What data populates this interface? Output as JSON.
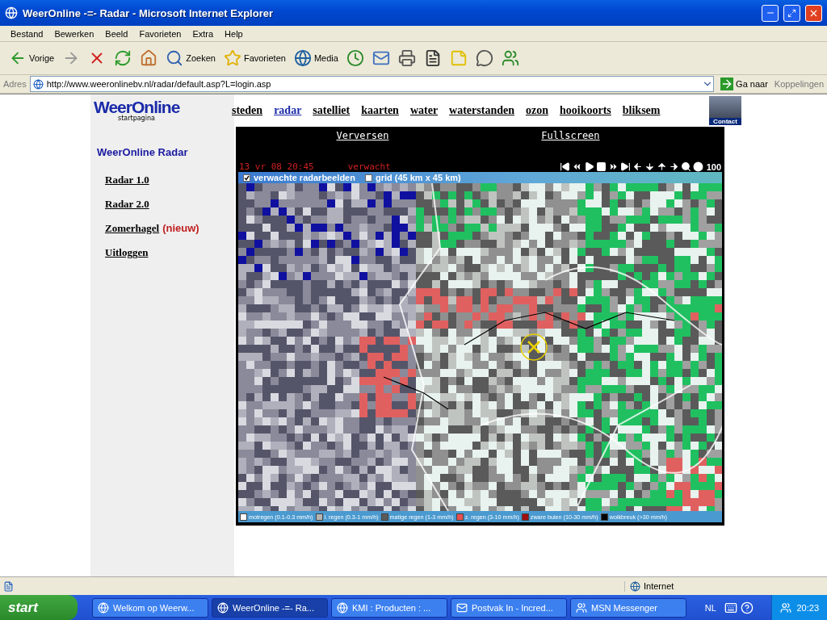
{
  "window": {
    "title": "WeerOnline -=- Radar - Microsoft Internet Explorer"
  },
  "menu": [
    "Bestand",
    "Bewerken",
    "Beeld",
    "Favorieten",
    "Extra",
    "Help"
  ],
  "toolbar": [
    {
      "kind": "back",
      "label": "Vorige"
    },
    {
      "kind": "forward"
    },
    {
      "kind": "stop"
    },
    {
      "kind": "refresh"
    },
    {
      "kind": "home"
    },
    {
      "kind": "search",
      "label": "Zoeken"
    },
    {
      "kind": "favorites",
      "label": "Favorieten"
    },
    {
      "kind": "media",
      "label": "Media"
    },
    {
      "kind": "history"
    },
    {
      "kind": "mail"
    },
    {
      "kind": "print"
    },
    {
      "kind": "edit"
    },
    {
      "kind": "note"
    },
    {
      "kind": "discuss"
    },
    {
      "kind": "messenger"
    }
  ],
  "address": {
    "label": "Adres",
    "url": "http://www.weeronlinebv.nl/radar/default.asp?L=login.asp",
    "go": "Ga naar",
    "links": "Koppelingen"
  },
  "site": {
    "logo": "WeerOnline",
    "logo_subtitle": "startpagina",
    "contact": "Contact",
    "nav": [
      {
        "label": "steden",
        "selected": false
      },
      {
        "label": "radar",
        "selected": true
      },
      {
        "label": "satelliet",
        "selected": false
      },
      {
        "label": "kaarten",
        "selected": false
      },
      {
        "label": "water",
        "selected": false
      },
      {
        "label": "waterstanden",
        "selected": false
      },
      {
        "label": "ozon",
        "selected": false
      },
      {
        "label": "hooikoorts",
        "selected": false
      },
      {
        "label": "bliksem",
        "selected": false
      }
    ],
    "sidebar": {
      "title": "WeerOnline Radar",
      "items": [
        {
          "label": "Radar 1.0"
        },
        {
          "label": "Radar 2.0"
        },
        {
          "label": "Zomerhagel",
          "badge": "(nieuw)"
        },
        {
          "label": "Uitloggen"
        }
      ]
    }
  },
  "radar": {
    "links": [
      "Verversen",
      "Fullscreen"
    ],
    "timestamp": "13 vr 08 20:45",
    "mode": "verwacht",
    "zoom": "100",
    "options": [
      {
        "label": "verwachte radarbeelden",
        "checked": true
      },
      {
        "label": "grid (45 km x 45 km)",
        "checked": false
      }
    ],
    "legend": [
      {
        "label": "motregen (0.1-0.3 mm/h)",
        "color": "#ffffff"
      },
      {
        "label": "l. regen (0.3-1 mm/h)",
        "color": "#b4b4b4"
      },
      {
        "label": "matige regen (1-3 mm/h)",
        "color": "#5a5a5a"
      },
      {
        "label": "z. regen (3-10 mm/h)",
        "color": "#e85050"
      },
      {
        "label": "zware buien (10-30 mm/h)",
        "color": "#a01010"
      },
      {
        "label": "wolkbreuk (>30 mm/h)",
        "color": "#000000"
      }
    ]
  },
  "status_bar": {
    "zone": "Internet"
  },
  "taskbar": {
    "start": "start",
    "tasks": [
      {
        "label": "Welkom op Weerw...",
        "kind": "ie",
        "selected": false
      },
      {
        "label": "WeerOnline -=- Ra...",
        "kind": "ie",
        "selected": true
      },
      {
        "label": "KMI : Producten : ...",
        "kind": "ie",
        "selected": false
      },
      {
        "label": "Postvak In - Incred...",
        "kind": "mail",
        "selected": false
      },
      {
        "label": "MSN Messenger",
        "kind": "msn",
        "selected": false
      }
    ],
    "language": "NL",
    "clock": "20:23"
  }
}
